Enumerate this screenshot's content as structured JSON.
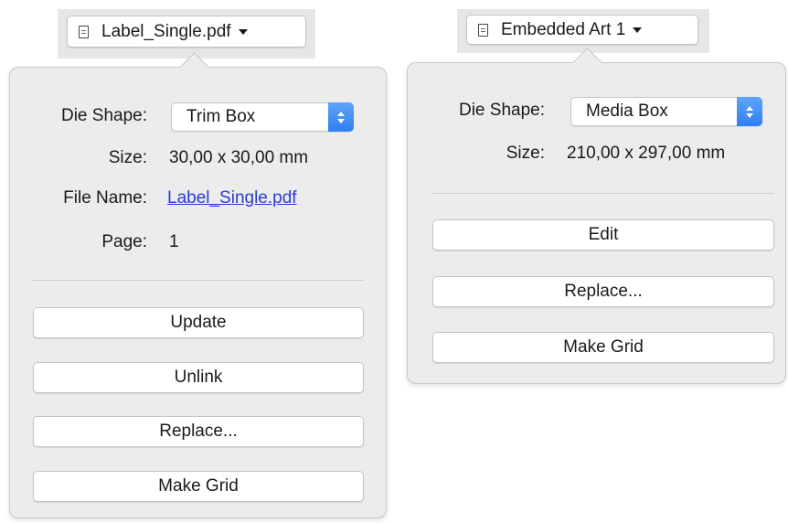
{
  "left_panel": {
    "trigger_label": "Label_Single.pdf",
    "trigger_icon": "document-icon",
    "die_shape_label": "Die Shape:",
    "die_shape_value": "Trim Box",
    "size_label": "Size:",
    "size_value": "30,00 x 30,00 mm",
    "file_name_label": "File Name:",
    "file_name_value": "Label_Single.pdf",
    "page_label": "Page:",
    "page_value": "1",
    "buttons": {
      "update": "Update",
      "unlink": "Unlink",
      "replace": "Replace...",
      "make_grid": "Make Grid"
    }
  },
  "right_panel": {
    "trigger_label": "Embedded Art 1",
    "trigger_icon": "document-icon",
    "die_shape_label": "Die Shape:",
    "die_shape_value": "Media Box",
    "size_label": "Size:",
    "size_value": "210,00 x 297,00 mm",
    "buttons": {
      "edit": "Edit",
      "replace": "Replace...",
      "make_grid": "Make Grid"
    }
  },
  "colors": {
    "panel_bg": "#ececec",
    "link": "#2b3bd6",
    "stepper_accent": "#2f7ff0"
  }
}
